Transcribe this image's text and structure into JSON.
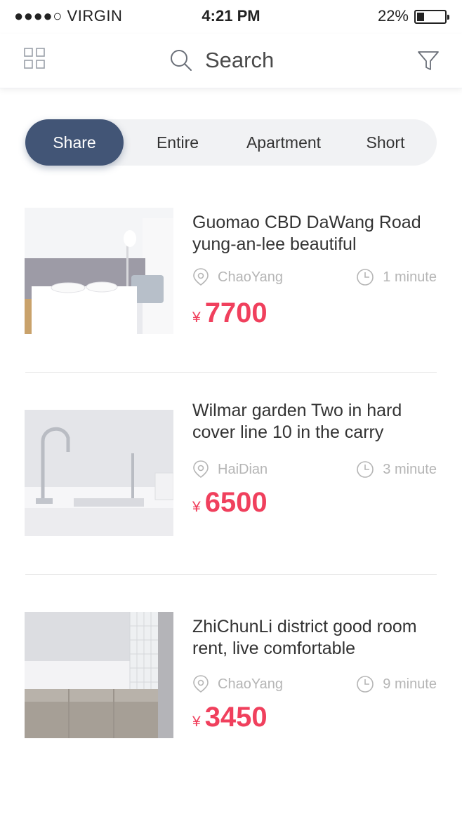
{
  "status_bar": {
    "carrier": "●●●●○ VIRGIN",
    "time": "4:21 PM",
    "battery": "22%"
  },
  "header": {
    "search_label": "Search"
  },
  "tabs": [
    {
      "label": "Share",
      "active": true
    },
    {
      "label": "Entire",
      "active": false
    },
    {
      "label": "Apartment",
      "active": false
    },
    {
      "label": "Short",
      "active": false
    }
  ],
  "listings": [
    {
      "title": "Guomao CBD DaWang Road yung-an-lee beautiful",
      "location": "ChaoYang",
      "time": "1 minute",
      "currency": "¥",
      "price": "7700"
    },
    {
      "title": "Wilmar garden Two in hard cover line 10 in the carry",
      "location": "HaiDian",
      "time": "3 minute",
      "currency": "¥",
      "price": "6500"
    },
    {
      "title": "ZhiChunLi district good room rent, live comfortable",
      "location": "ChaoYang",
      "time": "9 minute",
      "currency": "¥",
      "price": "3450"
    }
  ],
  "colors": {
    "accent": "#425576",
    "price": "#f0405d",
    "muted": "#b5b5b5"
  }
}
